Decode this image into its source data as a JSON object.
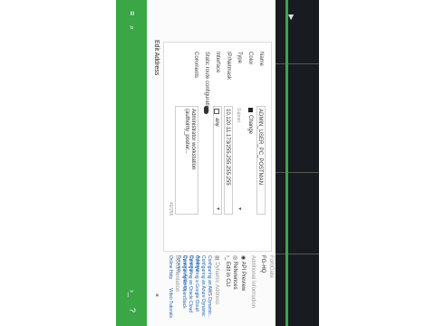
{
  "window": {
    "title": "Edit Address",
    "close": "×"
  },
  "form": {
    "name_label": "Name",
    "name_value": "ADMIN_USER_PC_POSTMAN",
    "color_label": "Color",
    "color_value": "Change",
    "type_label": "Type",
    "type_value": "Subnet",
    "ipnetmask_label": "IP/Netmask",
    "ipnetmask_value": "10.120.11.173/255.255.255.255",
    "interface_label": "Interface",
    "interface_value": "any",
    "static_route_label": "Static route configuration",
    "comments_label": "Comments",
    "comments_value": "Administrator workstation (authority_poster...",
    "comments_count": "49/255"
  },
  "right_panel": {
    "fortigate_label": "FortiGate",
    "fortigate_value": "FG-HQ",
    "additional_info": "Additional Information",
    "api_preview": "API Preview",
    "references": "References",
    "edit_in_cli": "Edit in CLI",
    "dynamic_address": "Dynamic Address",
    "config_aws": "Configuring an AWS Dynamic...",
    "config_azure": "Configuring an Azure Dynamic Address",
    "config_gcp": "Configuring a Google Cloud Dynamic...",
    "config_oci": "Configuring an Oracle Cloud Dynamic Address",
    "config_openstack": "Configuring an OpenStack Dynamic...",
    "documentation": "Documentation",
    "online_help": "Online Help",
    "video_tutorials": "Video Tutorials"
  },
  "colors": {
    "accent": "#3aa645",
    "topbar": "#181c20"
  }
}
